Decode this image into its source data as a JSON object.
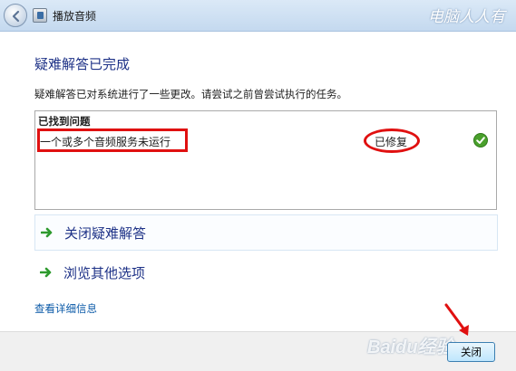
{
  "window": {
    "title": "播放音频",
    "watermark": "电脑人人有"
  },
  "main": {
    "heading": "疑难解答已完成",
    "description": "疑难解答已对系统进行了一些更改。请尝试之前曾尝试执行的任务。",
    "problems": {
      "header": "已找到问题",
      "items": [
        {
          "name": "一个或多个音频服务未运行",
          "status": "已修复",
          "status_icon": "green-check-icon"
        }
      ]
    },
    "options": [
      {
        "label": "关闭疑难解答",
        "icon": "green-arrow-icon"
      },
      {
        "label": "浏览其他选项",
        "icon": "green-arrow-icon"
      }
    ],
    "details_link": "查看详细信息"
  },
  "footer": {
    "close_label": "关闭",
    "watermark": "Baidu经验"
  },
  "colors": {
    "heading": "#1e3287",
    "link": "#0b5aa8",
    "highlight": "#e01010",
    "check": "#4aa02c"
  }
}
